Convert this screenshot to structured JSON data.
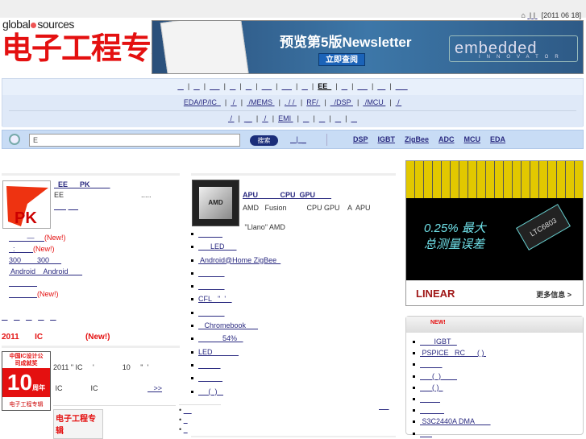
{
  "topbar": {
    "home_icon": "home-icon",
    "links": [
      " ",
      " ",
      " "
    ],
    "date": "[2011 06 18]"
  },
  "logo": {
    "brand": "global sources",
    "title": "电子工程专辑"
  },
  "banner": {
    "title": "预览第5版Newsletter",
    "button": "立即查阅",
    "brand": "embedded",
    "brand_sub": "INNOVATOR"
  },
  "nav": {
    "row1": [
      "   ",
      "   ",
      "     ",
      "   ",
      "   ",
      "     ",
      "     ",
      "   ",
      "EE  ",
      "   ",
      "     ",
      "    ",
      "      "
    ],
    "row2": [
      "EDA/IP/IC  ",
      " / ",
      " /MEMS ",
      ". / / ",
      "RF/ ",
      "  /DSP ",
      " /MCU ",
      " / "
    ],
    "row3": [
      " / ",
      " _ ",
      " / ",
      "EMI ",
      "   ",
      "   ",
      "   ",
      "   "
    ]
  },
  "search": {
    "value": "E",
    "button": "搜索",
    "mini": "   |  _",
    "keywords": [
      "DSP",
      "IGBT",
      "ZigBee",
      "ADC",
      "MCU",
      "EDA"
    ]
  },
  "left": {
    "pk": {
      "title": "  EE      PK          ",
      "desc": "EE",
      "more": ".....",
      "links": [
        "      ",
        "     "
      ],
      "img_label": "PK"
    },
    "list": [
      {
        "t": "         —     ",
        "new": "(New!)"
      },
      {
        "t": "  :         ",
        "new": "(New!)"
      },
      {
        "t": "300        300      ",
        "new": ""
      },
      {
        "t": " Android    Android       ",
        "new": ""
      },
      {
        "t": "              ",
        "new": ""
      },
      {
        "t": "              ",
        "new": "(New!)"
      }
    ],
    "tabs": [
      "   ",
      "   ",
      "   ",
      "   ",
      "   "
    ],
    "ic": {
      "heading": "2011       IC                   ",
      "heading_new": "(New!)",
      "line1": "2011 \" IC     '              10     \"  '",
      "line2": " IC              IC",
      "more": "   >>",
      "img_top": "中国IC设计公司成就奖",
      "img_num": "10",
      "img_side": "周年",
      "img_foot": "电子工程专辑"
    }
  },
  "mid": {
    "feature": {
      "title": "APU           CPU  GPU        ",
      "line1": "AMD   Fusion          CPU GPU    A  APU",
      "line2": " \"Llano\" AMD",
      "img_label": "AMD"
    },
    "list": [
      "            ",
      "      LED      ",
      " Android@Home ZigBee  ",
      "             ",
      "             ",
      "CFL   \"  '   ",
      "             ",
      "   Chromebook      ",
      "            54%   ",
      "LED             ",
      "           ",
      "            ",
      "     (  )   "
    ],
    "bottom": [
      "    ",
      "  ",
      "  "
    ],
    "bottom_right": "     "
  },
  "right": {
    "ad": {
      "big": "0.25% 最大\n总测量误差",
      "chip": "LTC6803",
      "brand": "LINEAR",
      "more": "更多信息 >"
    },
    "new_heading": "NEW!",
    "list": [
      "       IGBT   ",
      " PSPICE   RC      ( ) ",
      "           ",
      "      (  )        ",
      "      ( )  ",
      "          ",
      "            ",
      " S3C2440A DMA        ",
      "      "
    ]
  }
}
